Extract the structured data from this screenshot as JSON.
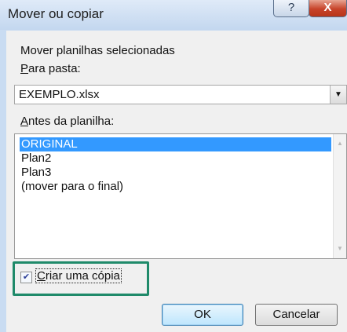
{
  "window": {
    "title": "Mover ou copiar",
    "help_label": "?",
    "close_label": "X"
  },
  "dialog": {
    "move_selected_label": "Mover planilhas selecionadas",
    "to_book": {
      "underline": "P",
      "rest": "ara pasta:"
    },
    "to_book_value": "EXEMPLO.xlsx",
    "before_sheet": {
      "underline": "A",
      "rest": "ntes da planilha:"
    },
    "sheets": [
      "ORIGINAL",
      "Plan2",
      "Plan3",
      "(mover para o final)"
    ],
    "selected_sheet": "ORIGINAL",
    "create_copy": {
      "underline": "C",
      "rest": "riar uma cópia",
      "checked": true
    },
    "ok_label": "OK",
    "cancel_label": "Cancelar"
  },
  "colors": {
    "selection": "#3399ff",
    "highlight_border": "#1f8a6a",
    "close_button": "#c7432a"
  }
}
